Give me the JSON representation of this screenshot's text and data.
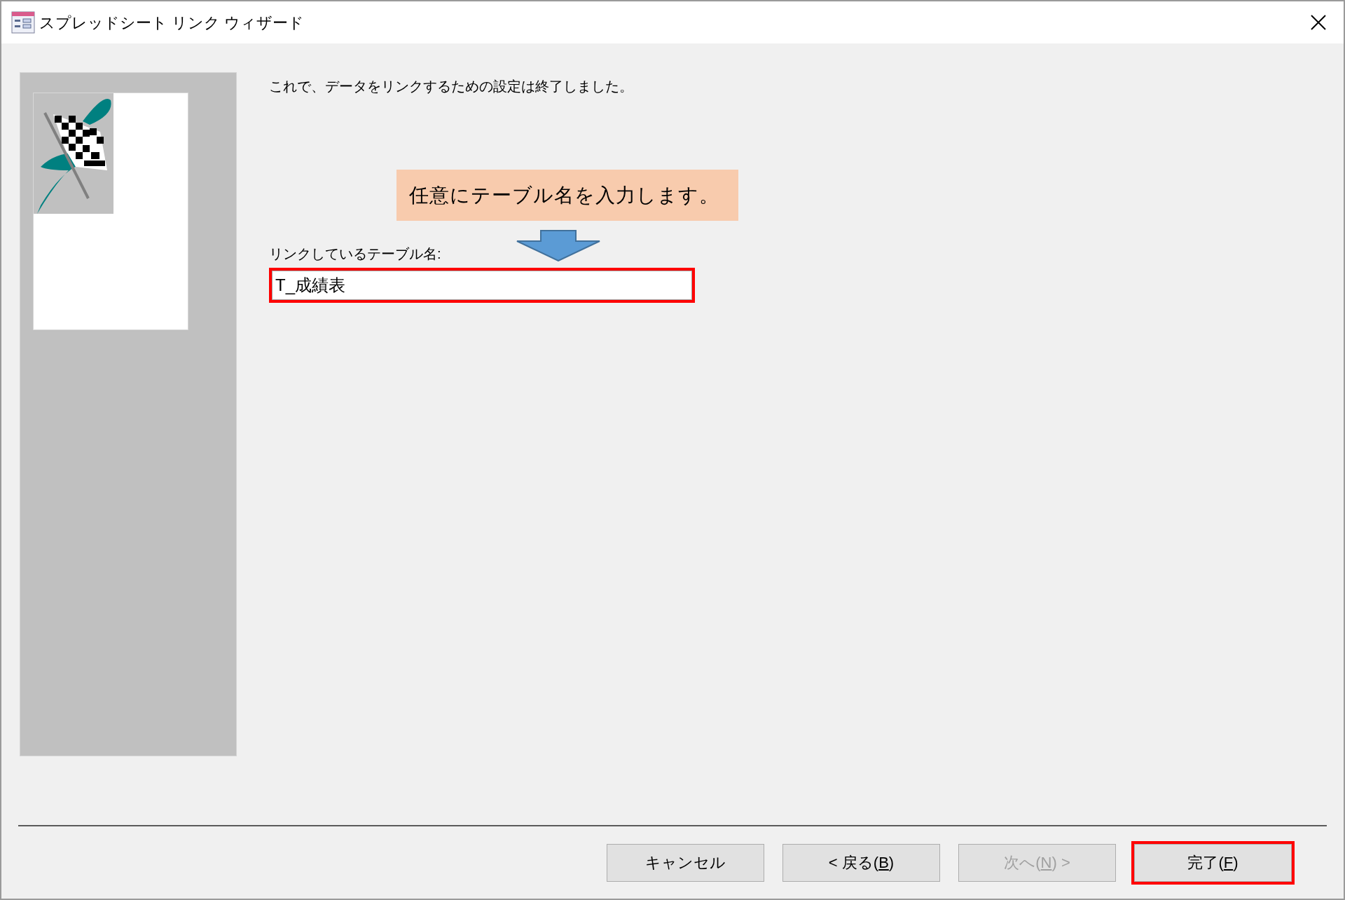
{
  "window": {
    "title": "スプレッドシート リンク ウィザード"
  },
  "message": "これで、データをリンクするための設定は終了しました。",
  "annotation": {
    "text": "任意にテーブル名を入力します。"
  },
  "table_name": {
    "label": "リンクしているテーブル名:",
    "value": "T_成績表",
    "highlighted": true
  },
  "buttons": [
    {
      "before": "キャンセル",
      "disabled": false,
      "highlighted": false
    },
    {
      "before": "< 戻る(",
      "key": "B",
      "after": ")",
      "disabled": false,
      "highlighted": false
    },
    {
      "before": "次へ(",
      "key": "N",
      "after": ") >",
      "disabled": true,
      "highlighted": false
    },
    {
      "before": "完了(",
      "key": "F",
      "after": ")",
      "disabled": false,
      "highlighted": true
    }
  ]
}
